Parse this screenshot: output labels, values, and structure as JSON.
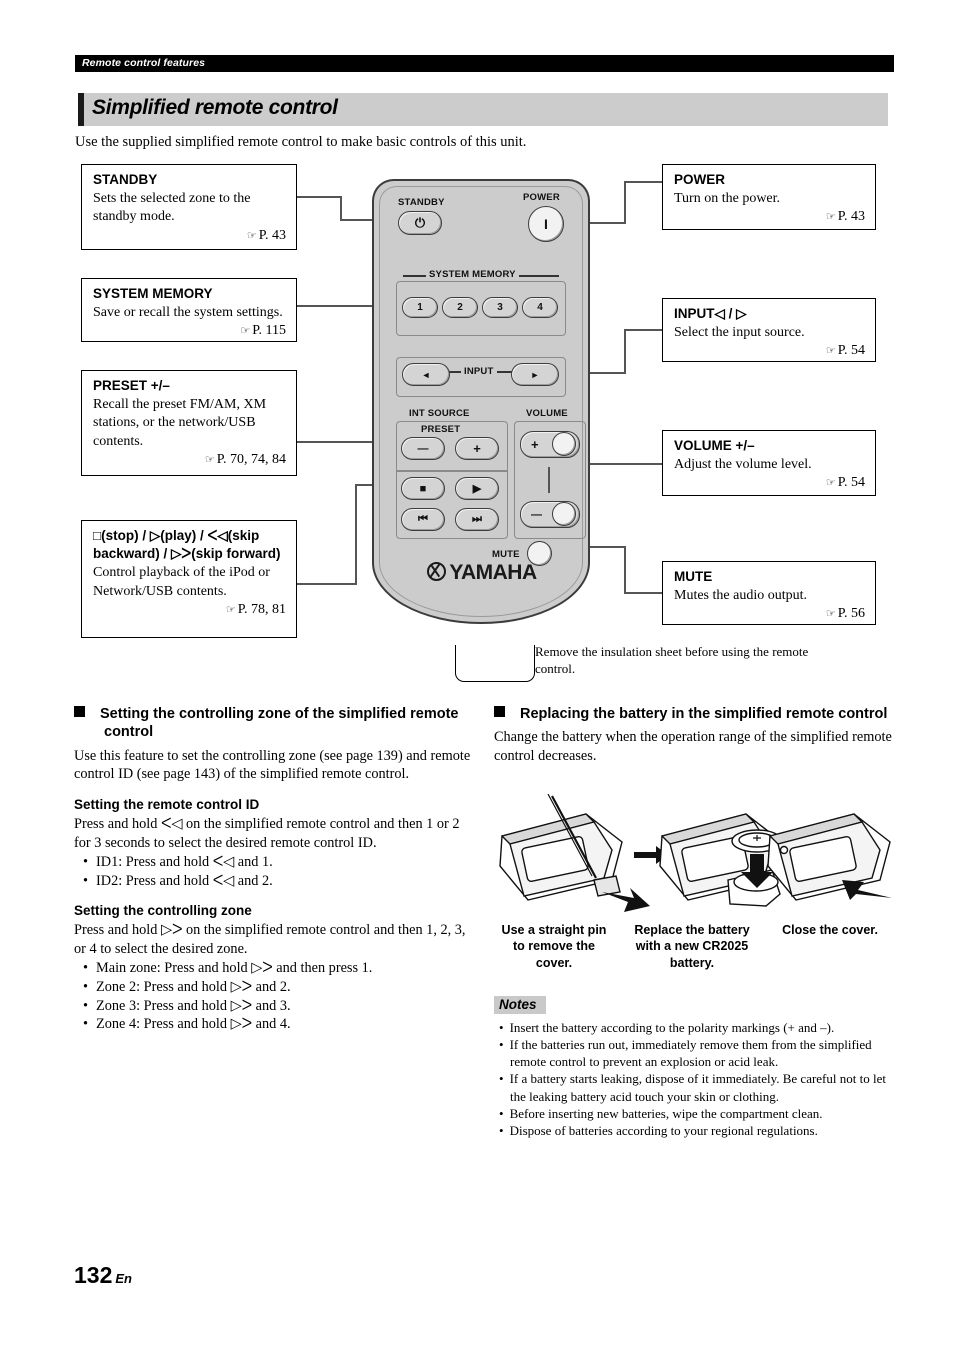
{
  "running_header": "Remote control features",
  "page_title": "Simplified remote control",
  "intro": "Use the supplied simplified remote control to make basic controls of this unit.",
  "callouts": {
    "standby": {
      "title": "STANDBY",
      "desc": "Sets the selected zone to the standby mode.",
      "page": "P. 43"
    },
    "system_memory": {
      "title": "SYSTEM MEMORY",
      "desc": "Save or recall the system settings.",
      "page": "P. 115"
    },
    "preset": {
      "title": "PRESET +/–",
      "desc": "Recall the preset FM/AM, XM stations, or the network/USB contents.",
      "page": "P. 70, 74, 84"
    },
    "transport": {
      "title": "□(stop) / ▷(play) / ᐸ◁(skip backward) / ▷ᐳ(skip forward)",
      "desc": "Control playback of the iPod or Network/USB contents.",
      "page": "P. 78, 81"
    },
    "power": {
      "title": "POWER",
      "desc": "Turn on the power.",
      "page": "P. 43"
    },
    "input": {
      "title": "INPUT◁ / ▷",
      "desc": "Select the input source.",
      "page": "P. 54"
    },
    "volume": {
      "title": "VOLUME +/–",
      "desc": "Adjust the volume level.",
      "page": "P. 54"
    },
    "mute": {
      "title": "MUTE",
      "desc": "Mutes the audio output.",
      "page": "P. 56"
    }
  },
  "remote": {
    "label_standby": "STANDBY",
    "label_power": "POWER",
    "label_system_memory": "SYSTEM MEMORY",
    "memory_buttons": [
      "1",
      "2",
      "3",
      "4"
    ],
    "label_input": "INPUT",
    "label_int_source": "INT SOURCE",
    "label_preset": "PRESET",
    "label_volume": "VOLUME",
    "label_mute": "MUTE",
    "brand": "YAMAHA",
    "power_glyph": "I",
    "standby_glyph": "⏻",
    "input_left_glyph": "◄",
    "input_right_glyph": "►",
    "preset_minus": "—",
    "preset_plus": "+",
    "stop_glyph": "■",
    "play_glyph": "▶",
    "skip_back_glyph": "⏮",
    "skip_fwd_glyph": "⏭",
    "vol_plus": "+",
    "vol_minus": "—"
  },
  "insulation_note": "Remove the insulation sheet before using the remote control.",
  "left_column": {
    "heading": "Setting the controlling zone of the simplified remote control",
    "paragraph": "Use this feature to set the controlling zone (see page 139) and remote control ID (see page 143) of the simplified remote control.",
    "sub1_heading": "Setting the remote control ID",
    "sub1_paragraph": "Press and hold ᐸ◁ on the simplified remote control and then 1 or 2 for 3 seconds to select the desired remote control ID.",
    "sub1_bullets": [
      "ID1: Press and hold ᐸ◁ and 1.",
      "ID2: Press and hold ᐸ◁ and 2."
    ],
    "sub2_heading": "Setting the controlling zone",
    "sub2_paragraph": "Press and hold ▷ᐳ on the simplified remote control and then 1, 2, 3, or 4 to select the desired zone.",
    "sub2_bullets": [
      "Main zone: Press and hold ▷ᐳ and then press 1.",
      "Zone 2: Press and hold ▷ᐳ and 2.",
      "Zone 3: Press and hold ▷ᐳ and 3.",
      "Zone 4: Press and hold ▷ᐳ and 4."
    ]
  },
  "right_column": {
    "heading": "Replacing the battery in the simplified remote control",
    "paragraph": "Change the battery when the operation range of the simplified remote control decreases.",
    "figure_captions": [
      "Use a straight pin to remove the cover.",
      "Replace the battery with a new CR2025 battery.",
      "Close the cover."
    ],
    "notes_heading": "Notes",
    "notes": [
      "Insert the battery according to the polarity markings (+ and –).",
      "If the batteries run out, immediately remove them from the simplified remote control to prevent an explosion or acid leak.",
      "If a battery starts leaking, dispose of it immediately. Be careful not to let the leaking battery acid touch your skin or clothing.",
      "Before inserting new batteries, wipe the compartment clean.",
      "Dispose of batteries according to your regional regulations."
    ]
  },
  "footer": {
    "page_number": "132",
    "lang": "En"
  },
  "colors": {
    "header_bar": "#000000",
    "title_bar": "#cccccc",
    "remote_body": "#cccccc",
    "notes_bg": "#c9c9c9"
  }
}
